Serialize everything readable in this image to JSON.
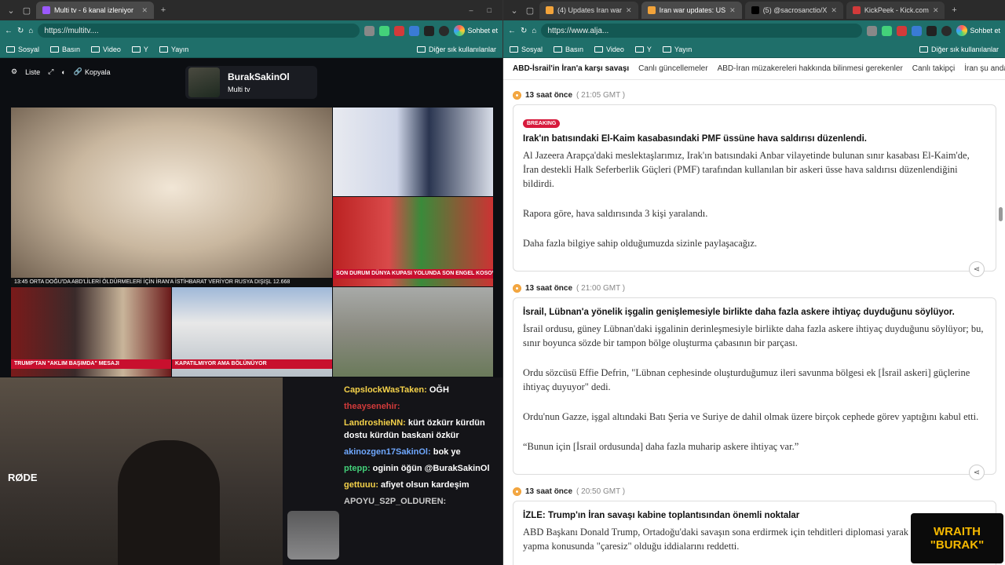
{
  "left": {
    "tabs": [
      {
        "label": "Multi tv - 6 kanal izleniyor",
        "fav": "#9b59ff"
      }
    ],
    "url": "https://multitv....",
    "chat_label": "Sohbet et",
    "bookmarks": [
      "Sosyal",
      "Basın",
      "Video",
      "Y",
      "Yayın"
    ],
    "other_bookmarks": "Diğer sık kullanılanlar",
    "controls": {
      "list": "Liste",
      "copy": "Kopyala"
    },
    "channel": {
      "name": "BurakSakinOl",
      "sub": "Multi tv"
    },
    "tiles": [
      {
        "ticker": "13:45   ORTA DOĞU'DA ABD'LİLERİ ÖLDÜRMELERİ İÇİN İRAN'A İSTİHBARAT VERİYOR      RUSYA DIŞIŞL   12.668"
      },
      {
        "ticker": "SON DURUM  DÜNYA KUPASI YOLUNDA SON ENGEL KOSOVA"
      },
      {
        "ticker": "TRUMP'TAN \"AKLIM BAŞIMDA\" MESAJI"
      },
      {
        "ticker": "KAPATILMIYOR AMA BÖLÜNÜYOR"
      }
    ],
    "chat": [
      {
        "user": "CapslockWasTaken:",
        "text": "OĞH",
        "color": "#f5d24a"
      },
      {
        "user": "theaysenehir:",
        "text": "",
        "color": "#d23a3a"
      },
      {
        "user": "LandroshieNN:",
        "text": "kürt özkürr kürdün dostu kürdün baskani özkür",
        "color": "#f5d24a"
      },
      {
        "user": "akinozgen17SakinOl:",
        "text": "bok ye",
        "color": "#6fa8ff"
      },
      {
        "user": "ptepp:",
        "text": "oginin öğün @BurakSakinOl",
        "color": "#43d17a"
      },
      {
        "user": "gettuuu:",
        "text": "afiyet olsun kardeşim",
        "color": "#f5d24a"
      },
      {
        "user": "APOYU_S2P_OLDUREN:",
        "text": "",
        "color": "#c9c9c9"
      }
    ]
  },
  "right": {
    "tabs": [
      {
        "label": "(4) Updates Iran war",
        "fav": "#f2a33a"
      },
      {
        "label": "Iran war updates: US",
        "fav": "#f2a33a"
      },
      {
        "label": "(5) @sacrosanctio/X",
        "fav": "#000000"
      },
      {
        "label": "KickPeek - Kick.com",
        "fav": "#d23a3a"
      }
    ],
    "url": "https://www.alja...",
    "chat_label": "Sohbet et",
    "bookmarks": [
      "Sosyal",
      "Basın",
      "Video",
      "Y",
      "Yayın"
    ],
    "other_bookmarks": "Diğer sık kullanılanlar",
    "subnav": [
      "ABD-İsrail'in İran'a karşı savaşı",
      "Canlı güncellemeler",
      "ABD-İran müzakereleri hakkında bilinmesi gerekenler",
      "Canlı takipçi",
      "İran şu anda dah"
    ],
    "entries": [
      {
        "time": "13 saat önce",
        "gmt": "( 21:05 GMT )",
        "badge": "BREAKING",
        "title": "Irak'ın batısındaki El-Kaim kasabasındaki PMF üssüne hava saldırısı düzenlendi.",
        "paras": [
          "Al Jazeera Arapça'daki meslektaşlarımız, Irak'ın batısındaki Anbar vilayetinde bulunan sınır kasabası El-Kaim'de, İran destekli Halk Seferberlik Güçleri (PMF) tarafından kullanılan bir askeri üsse hava saldırısı düzenlendiğini bildirdi.",
          "Rapora göre, hava saldırısında 3 kişi yaralandı.",
          "Daha fazla bilgiye sahip olduğumuzda sizinle paylaşacağız."
        ]
      },
      {
        "time": "13 saat önce",
        "gmt": "( 21:00 GMT )",
        "badge": "",
        "title": "İsrail, Lübnan'a yönelik işgalin genişlemesiyle birlikte daha fazla askere ihtiyaç duyduğunu söylüyor.",
        "paras": [
          "İsrail ordusu, güney Lübnan'daki işgalinin derinleşmesiyle birlikte daha fazla askere ihtiyaç duyduğunu söylüyor; bu, sınır boyunca sözde bir tampon bölge oluşturma çabasının bir parçası.",
          "Ordu sözcüsü Effie Defrin, \"Lübnan cephesinde oluşturduğumuz ileri savunma bölgesi ek [İsrail askeri] güçlerine ihtiyaç duyuyor\" dedi.",
          "Ordu'nun Gazze, işgal altındaki Batı Şeria ve Suriye de dahil olmak üzere birçok cephede görev yaptığını kabul etti.",
          "“Bunun için [İsrail ordusunda] daha fazla muharip askere ihtiyaç var.”"
        ]
      },
      {
        "time": "13 saat önce",
        "gmt": "( 20:50 GMT )",
        "badge": "",
        "title": "İZLE: Trump'ın İran savaşı kabine toplantısından önemli noktalar",
        "paras": [
          "ABD Başkanı Donald Trump, Ortadoğu'daki savaşın sona erdirmek için tehditleri diplomasi yarak İran'la bir anlaşma yapma konusunda \"çaresiz\" olduğu iddialarını reddetti."
        ]
      }
    ]
  },
  "overlay": {
    "line1": "WRAITH",
    "line2": "\"BURAK\""
  }
}
